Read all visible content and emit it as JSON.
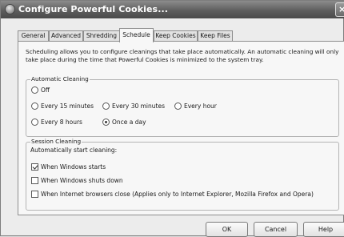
{
  "window": {
    "title": "Configure Powerful Cookies..."
  },
  "tabs": [
    "General",
    "Advanced",
    "Shredding",
    "Schedule",
    "Keep Cookies",
    "Keep Files"
  ],
  "active_tab": "Schedule",
  "intro": "Scheduling allows you to configure cleanings that take place automatically. An automatic cleaning will only take place during the time that Powerful Cookies is minimized to the system tray.",
  "automatic": {
    "legend": "Automatic Cleaning",
    "options": [
      "Off",
      "Every 15 minutes",
      "Every 30 minutes",
      "Every hour",
      "Every 8 hours",
      "Once a day"
    ],
    "selected": "Once a day"
  },
  "session": {
    "legend": "Session Cleaning",
    "subtitle": "Automatically start cleaning:",
    "checks": [
      {
        "label": "When Windows starts",
        "checked": true
      },
      {
        "label": "When Windows shuts down",
        "checked": false
      },
      {
        "label": "When Internet browsers close (Applies only to Internet Explorer, Mozilla Firefox and Opera)",
        "checked": false
      }
    ]
  },
  "buttons": {
    "ok": "OK",
    "cancel": "Cancel",
    "help": "Help"
  }
}
